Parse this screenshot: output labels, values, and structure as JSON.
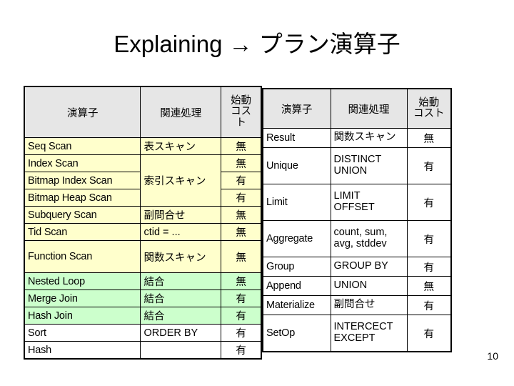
{
  "slide": {
    "title": "Explaining → プラン演算子",
    "page_number": "10",
    "colors": {
      "header_bg": "#e6e6e6",
      "scan_row_bg": "#ffffcc",
      "join_row_bg": "#ccffcc",
      "plain_row_bg": "#ffffff",
      "cost_yes": "#9c3131",
      "cost_no": "#000000",
      "border": "#000000"
    }
  },
  "left_table": {
    "headers": {
      "operator": "演算子",
      "related": "関連処理",
      "startup_cost_l1": "始動",
      "startup_cost_l2": "コス",
      "startup_cost_l3": "ト"
    },
    "rows": [
      {
        "operator": "Seq Scan",
        "related": "表スキャン",
        "cost": "無"
      },
      {
        "operator": "Index Scan",
        "related": "索引スキャン",
        "cost": "無"
      },
      {
        "operator": "Bitmap Index Scan",
        "related": "",
        "cost": "有"
      },
      {
        "operator": "Bitmap Heap Scan",
        "related": "",
        "cost": "有"
      },
      {
        "operator": "Subquery Scan",
        "related": "副問合せ",
        "cost": "無"
      },
      {
        "operator": "Tid Scan",
        "related": "ctid = ...",
        "cost": "無"
      },
      {
        "operator": "Function Scan",
        "related": "関数スキャン",
        "cost": "無"
      },
      {
        "operator": "Nested Loop",
        "related": "結合",
        "cost": "無"
      },
      {
        "operator": "Merge Join",
        "related": "結合",
        "cost": "有"
      },
      {
        "operator": "Hash Join",
        "related": "結合",
        "cost": "有"
      },
      {
        "operator": "Sort",
        "related": "ORDER BY",
        "cost": "有"
      },
      {
        "operator": "Hash",
        "related": "",
        "cost": "有"
      }
    ]
  },
  "right_table": {
    "headers": {
      "operator": "演算子",
      "related": "関連処理",
      "startup_cost_l1": "始動",
      "startup_cost_l2": "コスト"
    },
    "rows": [
      {
        "operator": "Result",
        "related_l1": "関数スキャン",
        "related_l2": "",
        "cost": "無"
      },
      {
        "operator": "Unique",
        "related_l1": "DISTINCT",
        "related_l2": "UNION",
        "cost": "有"
      },
      {
        "operator": "Limit",
        "related_l1": "LIMIT",
        "related_l2": "OFFSET",
        "cost": "有"
      },
      {
        "operator": "Aggregate",
        "related_l1": "count, sum,",
        "related_l2": "avg, stddev",
        "cost": "有"
      },
      {
        "operator": "Group",
        "related_l1": "GROUP BY",
        "related_l2": "",
        "cost": "有"
      },
      {
        "operator": "Append",
        "related_l1": "UNION",
        "related_l2": "",
        "cost": "無"
      },
      {
        "operator": "Materialize",
        "related_l1": "副問合せ",
        "related_l2": "",
        "cost": "有"
      },
      {
        "operator": "SetOp",
        "related_l1": "INTERCECT",
        "related_l2": "EXCEPT",
        "cost": "有"
      }
    ]
  }
}
